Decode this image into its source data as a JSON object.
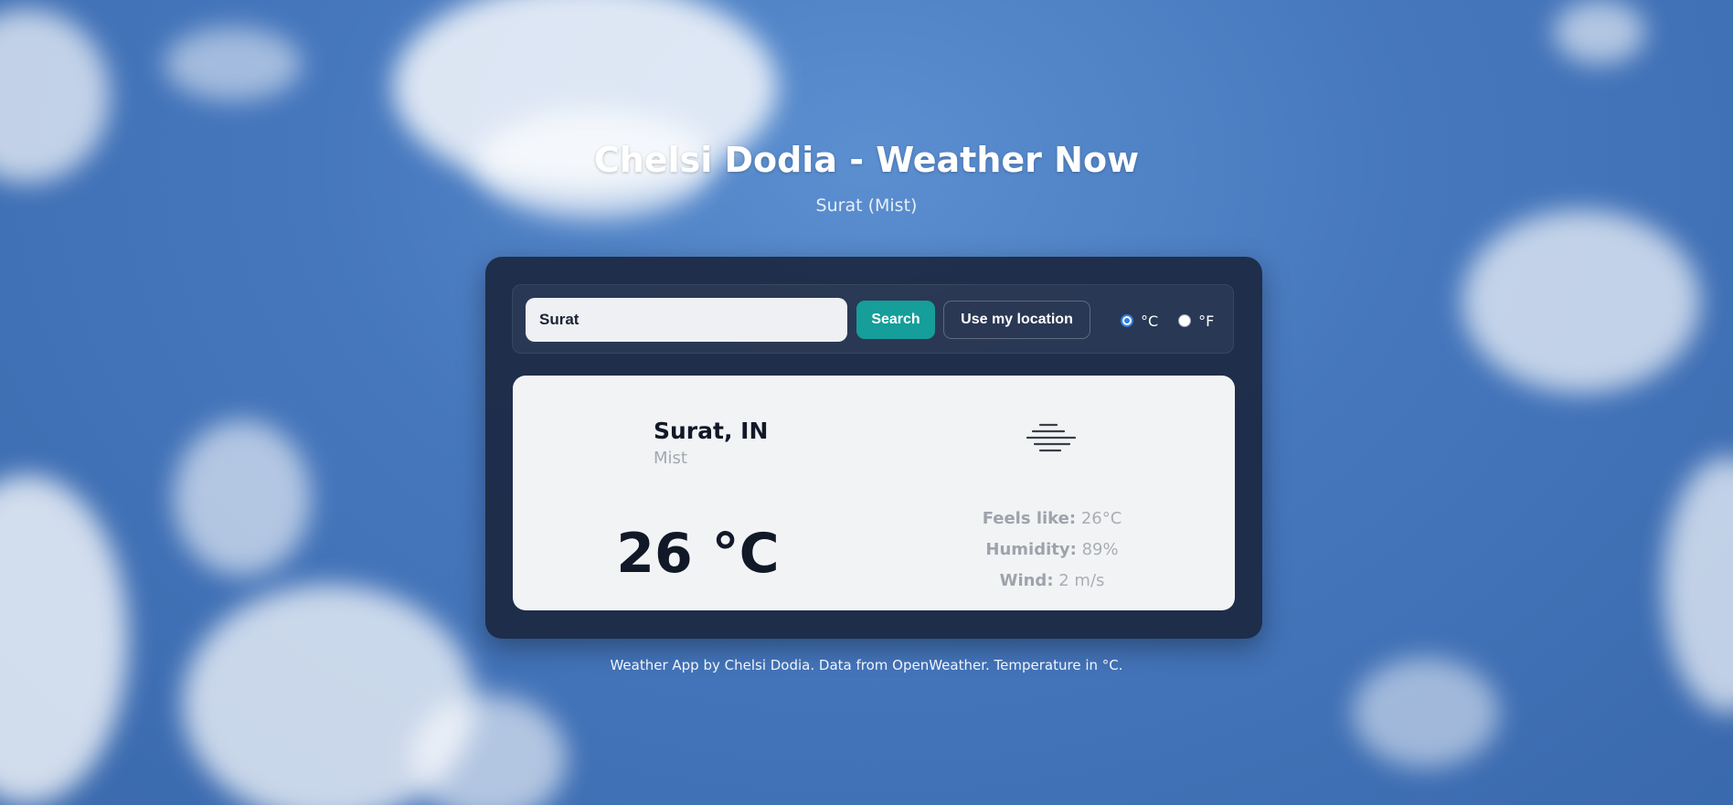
{
  "header": {
    "title": "Chelsi Dodia - Weather Now",
    "subtitle": "Surat (Mist)"
  },
  "search": {
    "value": "Surat",
    "placeholder": "",
    "search_label": "Search",
    "location_label": "Use my location"
  },
  "units": {
    "options": [
      "°C",
      "°F"
    ],
    "selected": "°C"
  },
  "weather": {
    "city": "Surat, IN",
    "condition": "Mist",
    "icon": "mist-icon",
    "temperature": "26 °C",
    "feels_like_label": "Feels like:",
    "feels_like_value": "26°C",
    "humidity_label": "Humidity:",
    "humidity_value": "89%",
    "wind_label": "Wind:",
    "wind_value": "2 m/s"
  },
  "footer": {
    "text": "Weather App by Chelsi Dodia. Data from OpenWeather. Temperature in °C."
  },
  "colors": {
    "accent": "#159e9a",
    "panel": "#1b2842",
    "card": "#f2f3f5",
    "sky": "#4677bd"
  }
}
